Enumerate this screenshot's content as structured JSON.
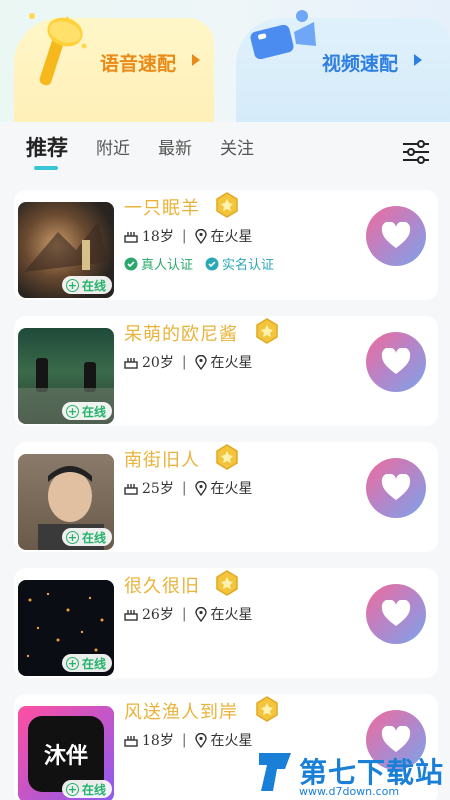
{
  "speed_match": {
    "voice_label": "语音速配",
    "video_label": "视频速配"
  },
  "tabs": [
    {
      "label": "推荐",
      "active": true
    },
    {
      "label": "附近",
      "active": false
    },
    {
      "label": "最新",
      "active": false
    },
    {
      "label": "关注",
      "active": false
    }
  ],
  "users": [
    {
      "name": "一只眠羊",
      "age": "18岁",
      "location": "在火星",
      "online": "在线",
      "verifications": [
        "真人认证",
        "实名认证"
      ]
    },
    {
      "name": "呆萌的欧尼酱",
      "age": "20岁",
      "location": "在火星",
      "online": "在线"
    },
    {
      "name": "南街旧人",
      "age": "25岁",
      "location": "在火星",
      "online": "在线"
    },
    {
      "name": "很久很旧",
      "age": "26岁",
      "location": "在火星",
      "online": "在线"
    },
    {
      "name": "风送渔人到岸",
      "age": "18岁",
      "location": "在火星",
      "online": "在线",
      "avatar_text": "沐伴"
    }
  ],
  "watermark": {
    "title": "第七下载站",
    "url": "www.d7down.com"
  },
  "colors": {
    "accent": "#37c6d6",
    "name": "#e8b33a",
    "online": "#23b36b",
    "voice": "#e88b1a",
    "video": "#2f7fe0"
  }
}
